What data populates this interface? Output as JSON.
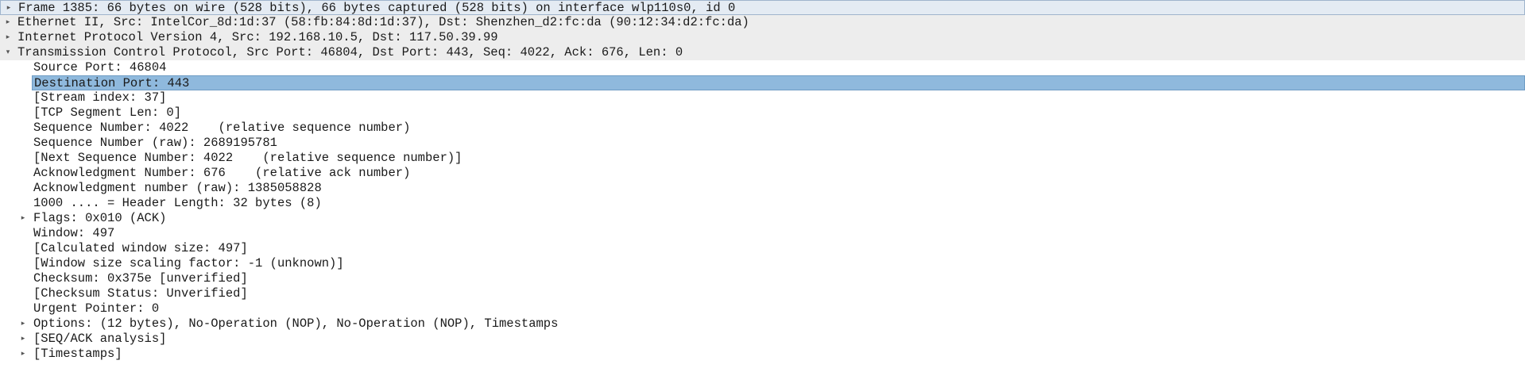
{
  "packet_details": {
    "rows": [
      {
        "level": 0,
        "expander": "collapsed",
        "style": "frame",
        "name": "frame-row",
        "text": "Frame 1385: 66 bytes on wire (528 bits), 66 bytes captured (528 bits) on interface wlp110s0, id 0"
      },
      {
        "level": 0,
        "expander": "collapsed",
        "style": "top-level",
        "name": "ethernet-row",
        "text": "Ethernet II, Src: IntelCor_8d:1d:37 (58:fb:84:8d:1d:37), Dst: Shenzhen_d2:fc:da (90:12:34:d2:fc:da)"
      },
      {
        "level": 0,
        "expander": "collapsed",
        "style": "top-level",
        "name": "ipv4-row",
        "text": "Internet Protocol Version 4, Src: 192.168.10.5, Dst: 117.50.39.99"
      },
      {
        "level": 0,
        "expander": "expanded",
        "style": "top-level",
        "name": "tcp-row",
        "text": "Transmission Control Protocol, Src Port: 46804, Dst Port: 443, Seq: 4022, Ack: 676, Len: 0"
      },
      {
        "level": 1,
        "expander": "none",
        "style": "",
        "name": "source-port-row",
        "text": "Source Port: 46804"
      },
      {
        "level": 1,
        "expander": "none",
        "style": "selected",
        "name": "destination-port-row",
        "text": "Destination Port: 443"
      },
      {
        "level": 1,
        "expander": "none",
        "style": "",
        "name": "stream-index-row",
        "text": "[Stream index: 37]"
      },
      {
        "level": 1,
        "expander": "none",
        "style": "",
        "name": "tcp-segment-len-row",
        "text": "[TCP Segment Len: 0]"
      },
      {
        "level": 1,
        "expander": "none",
        "style": "",
        "name": "sequence-number-row",
        "text": "Sequence Number: 4022    (relative sequence number)"
      },
      {
        "level": 1,
        "expander": "none",
        "style": "",
        "name": "sequence-number-raw-row",
        "text": "Sequence Number (raw): 2689195781"
      },
      {
        "level": 1,
        "expander": "none",
        "style": "",
        "name": "next-sequence-number-row",
        "text": "[Next Sequence Number: 4022    (relative sequence number)]"
      },
      {
        "level": 1,
        "expander": "none",
        "style": "",
        "name": "ack-number-row",
        "text": "Acknowledgment Number: 676    (relative ack number)"
      },
      {
        "level": 1,
        "expander": "none",
        "style": "",
        "name": "ack-number-raw-row",
        "text": "Acknowledgment number (raw): 1385058828"
      },
      {
        "level": 1,
        "expander": "none",
        "style": "",
        "name": "header-length-row",
        "text": "1000 .... = Header Length: 32 bytes (8)"
      },
      {
        "level": 1,
        "expander": "collapsed",
        "style": "",
        "name": "flags-row",
        "text": "Flags: 0x010 (ACK)"
      },
      {
        "level": 1,
        "expander": "none",
        "style": "",
        "name": "window-row",
        "text": "Window: 497"
      },
      {
        "level": 1,
        "expander": "none",
        "style": "",
        "name": "calculated-window-size-row",
        "text": "[Calculated window size: 497]"
      },
      {
        "level": 1,
        "expander": "none",
        "style": "",
        "name": "window-scaling-factor-row",
        "text": "[Window size scaling factor: -1 (unknown)]"
      },
      {
        "level": 1,
        "expander": "none",
        "style": "",
        "name": "checksum-row",
        "text": "Checksum: 0x375e [unverified]"
      },
      {
        "level": 1,
        "expander": "none",
        "style": "",
        "name": "checksum-status-row",
        "text": "[Checksum Status: Unverified]"
      },
      {
        "level": 1,
        "expander": "none",
        "style": "",
        "name": "urgent-pointer-row",
        "text": "Urgent Pointer: 0"
      },
      {
        "level": 1,
        "expander": "collapsed",
        "style": "",
        "name": "options-row",
        "text": "Options: (12 bytes), No-Operation (NOP), No-Operation (NOP), Timestamps"
      },
      {
        "level": 1,
        "expander": "collapsed",
        "style": "",
        "name": "seq-ack-analysis-row",
        "text": "[SEQ/ACK analysis]"
      },
      {
        "level": 1,
        "expander": "collapsed",
        "style": "",
        "name": "timestamps-row",
        "text": "[Timestamps]"
      }
    ]
  },
  "icons": {
    "collapsed": "chevron-right-icon",
    "expanded": "chevron-down-icon"
  },
  "glyphs": {
    "collapsed": "▸",
    "expanded": "▾"
  },
  "colors": {
    "selection": "#8fb9dd",
    "top_level_background": "#ededed",
    "frame_background": "#e4ebf3",
    "text": "#1a1a1a"
  }
}
